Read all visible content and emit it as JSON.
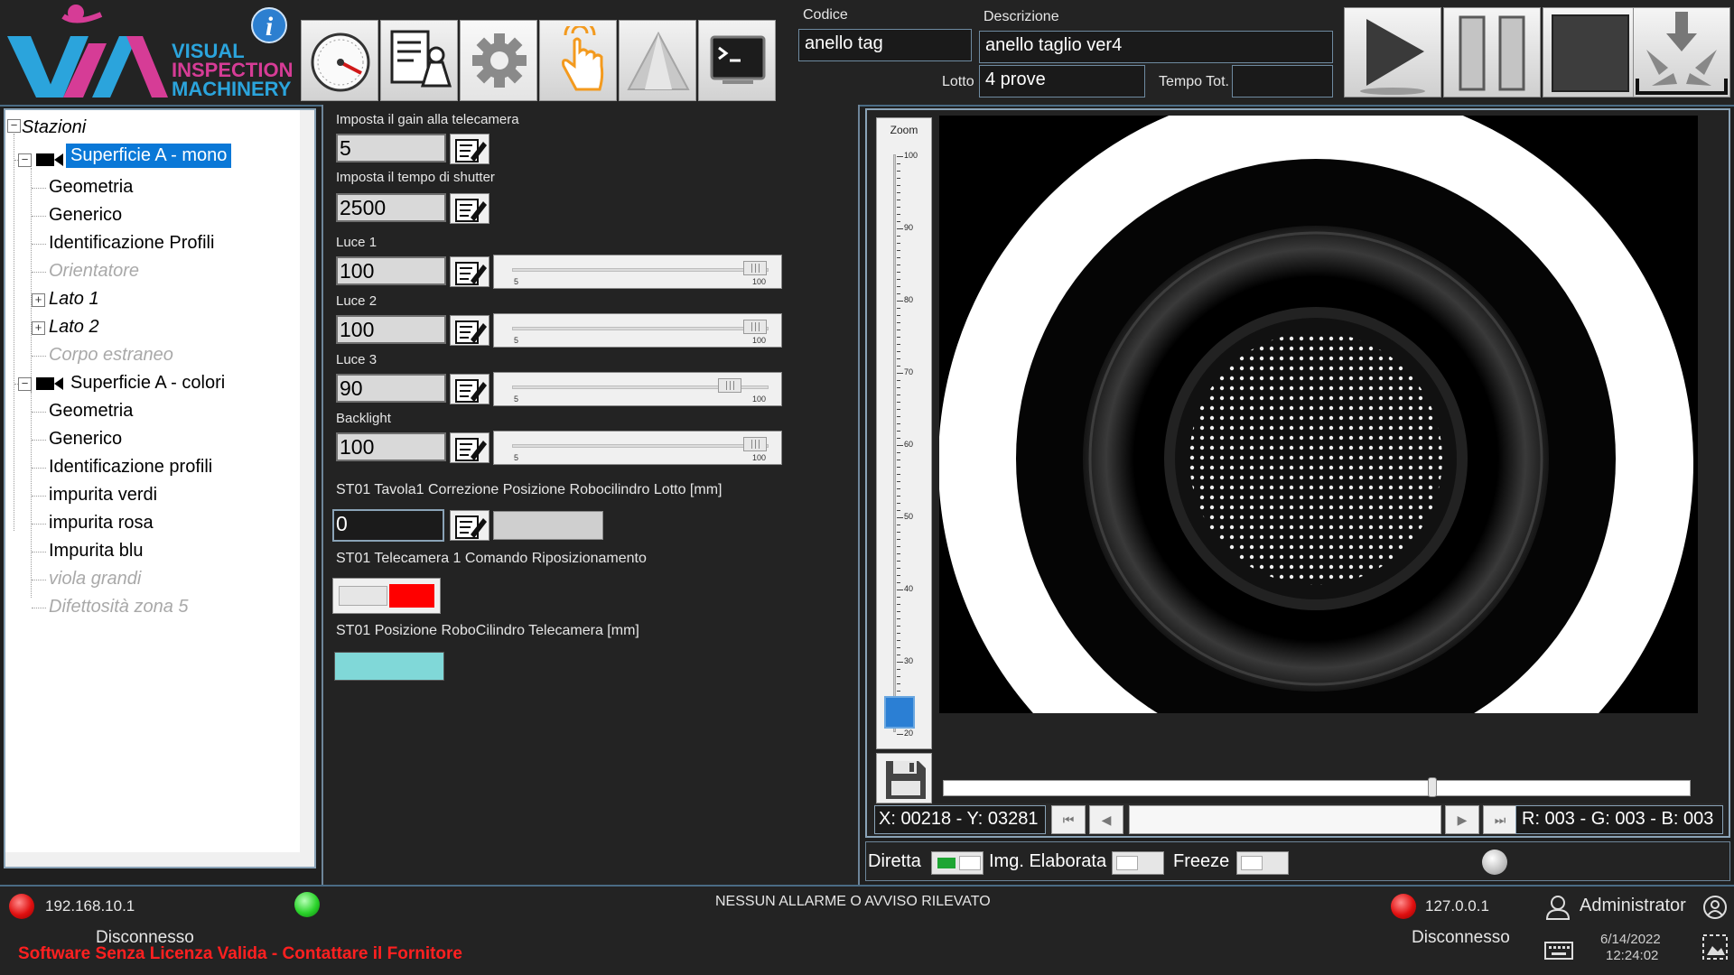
{
  "logo": {
    "brand_line1": "VISUAL",
    "brand_line2": "INSPECTION",
    "brand_line3": "MACHINERY",
    "info_glyph": "i",
    "colors": {
      "cyan": "#2ba4dc",
      "magenta": "#d63c96"
    }
  },
  "toolbar": {
    "buttons": [
      "speedometer-icon",
      "document-edit-icon",
      "gear-icon",
      "touch-hand-icon",
      "triangle-icon",
      "terminal-icon"
    ]
  },
  "header": {
    "codice_label": "Codice",
    "codice_value": "anello tag",
    "descrizione_label": "Descrizione",
    "descrizione_value": "anello taglio ver4",
    "lotto_label": "Lotto",
    "lotto_value": "4 prove",
    "tempo_label": "Tempo Tot.",
    "tempo_value": ""
  },
  "controls": [
    "play-icon",
    "pause-icon",
    "stop-icon",
    "download-arrows-icon"
  ],
  "tree": {
    "root": "Stazioni",
    "station1": {
      "label": "Superficie A - mono",
      "children": [
        "Geometria",
        "Generico",
        "Identificazione Profili",
        "Orientatore",
        "Lato 1",
        "Lato 2",
        "Corpo estraneo"
      ]
    },
    "station2": {
      "label": "Superficie A - colori",
      "children": [
        "Geometria",
        "Generico",
        "Identificazione profili",
        "impurita verdi",
        "impurita rosa",
        "Impurita blu",
        "viola grandi",
        "Difettosità zona 5"
      ]
    }
  },
  "settings": {
    "gain_label": "Imposta il gain alla telecamera",
    "gain_value": "5",
    "shutter_label": "Imposta il tempo di shutter",
    "shutter_value": "2500",
    "luce1_label": "Luce 1",
    "luce1_value": "100",
    "luce2_label": "Luce 2",
    "luce2_value": "100",
    "luce3_label": "Luce 3",
    "luce3_value": "90",
    "backlight_label": "Backlight",
    "backlight_value": "100",
    "slider_min": "5",
    "slider_max": "100",
    "correzione_label": "ST01 Tavola1 Correzione Posizione Robocilindro Lotto [mm]",
    "correzione_value": "0",
    "comando_label": "ST01 Telecamera 1 Comando Riposizionamento",
    "posizione_label": "ST01 Posizione RoboCilindro Telecamera [mm]",
    "colors": {
      "toggle_off": "#ff0000",
      "position_field": "#80d8d8"
    }
  },
  "viewer": {
    "zoom_label": "Zoom",
    "zoom_ticks": [
      "100",
      "90",
      "80",
      "70",
      "60",
      "50",
      "40",
      "30",
      "20"
    ],
    "zoom_level": 20,
    "coords": "X: 00218 - Y: 03281",
    "rgb": "R: 003 - G: 003 - B: 003",
    "frame_position": 0.65
  },
  "modes": {
    "diretta": "Diretta",
    "elaborata": "Img. Elaborata",
    "freeze": "Freeze"
  },
  "status": {
    "ip_left": "192.168.10.1",
    "conn_left": "Disconnesso",
    "license": "Software Senza Licenza Valida - Contattare il Fornitore",
    "alarm": "NESSUN ALLARME O AVVISO RILEVATO",
    "ip_right": "127.0.0.1",
    "conn_right": "Disconnesso",
    "user": "Administrator",
    "date": "6/14/2022",
    "time": "12:24:02",
    "colors": {
      "license": "#ff2020",
      "led_off": "#e01010",
      "led_on": "#2bd42b"
    }
  }
}
